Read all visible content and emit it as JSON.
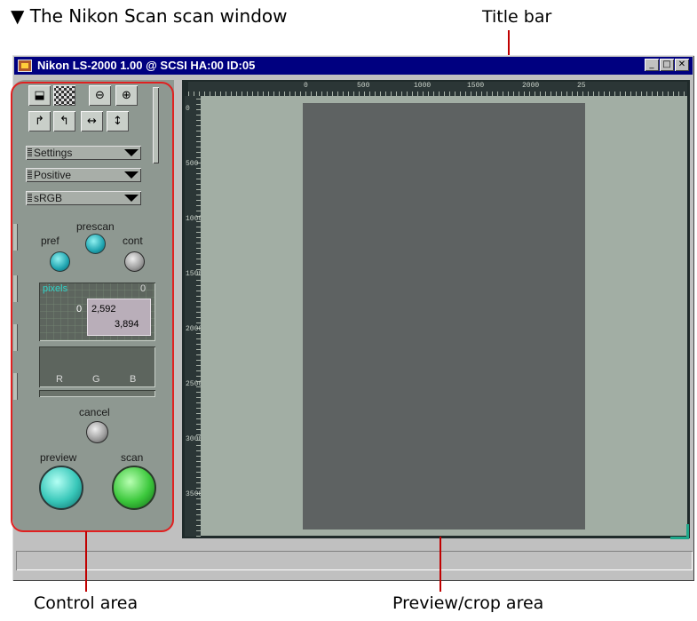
{
  "heading": "▼ The Nikon Scan scan window",
  "captions": {
    "title_bar": "Title bar",
    "control_area": "Control area",
    "preview_area": "Preview/crop area"
  },
  "window": {
    "title": "Nikon LS-2000 1.00 @ SCSI HA:00 ID:05",
    "minimize": "_",
    "maximize": "□",
    "close": "✕"
  },
  "controls": {
    "dropdowns": [
      "Settings",
      "Positive",
      "sRGB"
    ],
    "prescan_label": "prescan",
    "pref_label": "pref",
    "cont_label": "cont",
    "info": {
      "units": "pixels",
      "top_right": "0",
      "left": "0",
      "width": "2,592",
      "height": "3,894"
    },
    "histogram": {
      "r": "R",
      "g": "G",
      "b": "B"
    },
    "cancel_label": "cancel",
    "preview_label": "preview",
    "scan_label": "scan"
  },
  "rulers": {
    "top": [
      "0",
      "500",
      "1000",
      "1500",
      "2000",
      "25"
    ],
    "left": [
      "0",
      "500",
      "1000",
      "1500",
      "2000",
      "2500",
      "3000",
      "3500"
    ]
  },
  "colors": {
    "title_bar": "#000080",
    "annotation": "#e02020",
    "panel": "#8e9891",
    "preview_bg": "#a2aea4",
    "preview_image": "#5e6262"
  }
}
